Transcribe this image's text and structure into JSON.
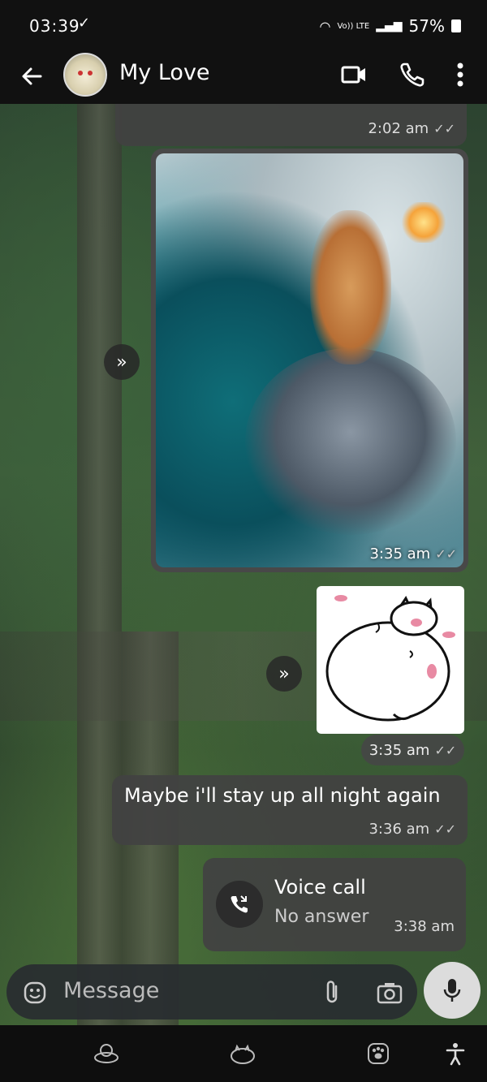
{
  "status": {
    "time": "03:39",
    "network": "Vo)) LTE",
    "battery": "57%"
  },
  "header": {
    "contact_name": "My Love"
  },
  "messages": {
    "first_time": "2:02 am",
    "image_time": "3:35 am",
    "sticker_time": "3:35 am",
    "text_body": "Maybe i'll stay up all night again",
    "text_time": "3:36 am",
    "call_title": "Voice call",
    "call_status": "No answer",
    "call_time": "3:38 am"
  },
  "composer": {
    "placeholder": "Message"
  },
  "icons": {
    "back": "back-arrow-icon",
    "video": "video-camera-icon",
    "phone": "phone-icon",
    "more": "more-vertical-icon",
    "forward": "forward-icon",
    "emoji": "emoji-icon",
    "attach": "paperclip-icon",
    "camera": "camera-icon",
    "mic": "microphone-icon",
    "accessibility": "accessibility-icon"
  }
}
